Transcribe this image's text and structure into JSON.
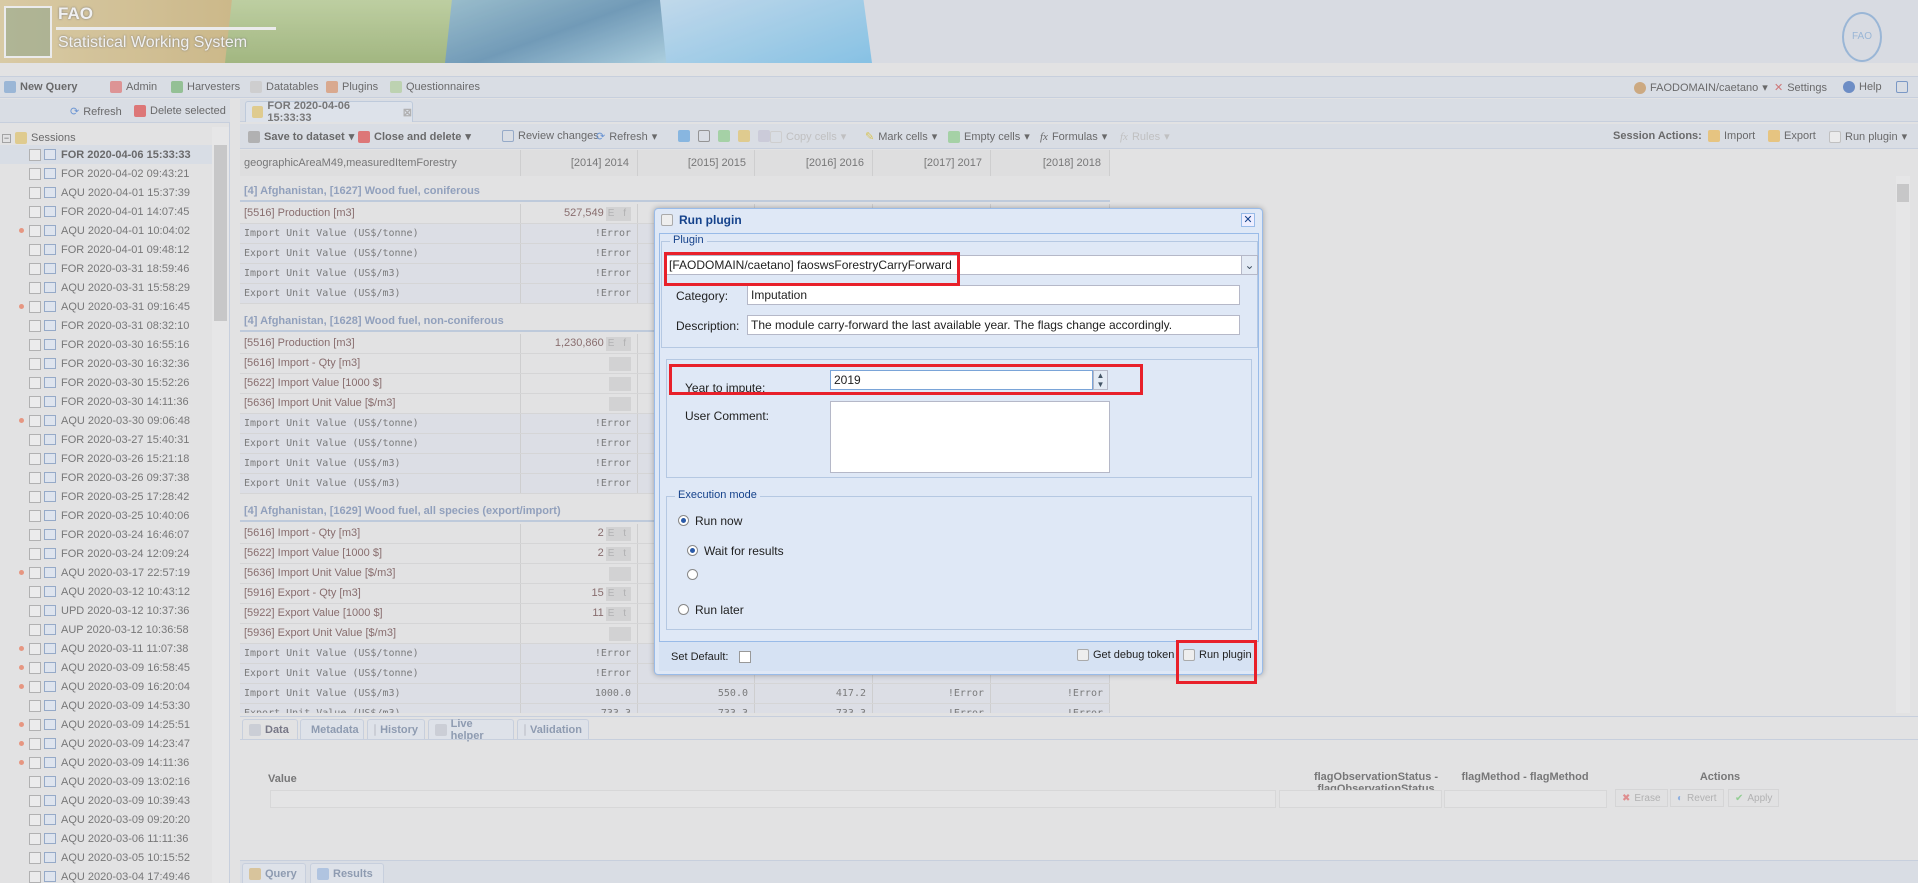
{
  "banner": {
    "app": "FAO",
    "subtitle": "Statistical Working System",
    "seal": "FAO"
  },
  "mainbar": {
    "new_query": "New Query",
    "admin": "Admin",
    "harvesters": "Harvesters",
    "datatables": "Datatables",
    "plugins": "Plugins",
    "questionnaires": "Questionnaires",
    "user": "FAODOMAIN/caetano",
    "settings": "Settings",
    "help": "Help"
  },
  "left": {
    "refresh": "Refresh",
    "delete_selected": "Delete selected",
    "sessions_label": "Sessions",
    "sessions": [
      {
        "name": "FOR 2020-04-06 15:33:33",
        "selected": true,
        "marked": false
      },
      {
        "name": "FOR 2020-04-02 09:43:21",
        "marked": false
      },
      {
        "name": "AQU 2020-04-01 15:37:39",
        "marked": false
      },
      {
        "name": "FOR 2020-04-01 14:07:45",
        "marked": false
      },
      {
        "name": "AQU 2020-04-01 10:04:02",
        "marked": true
      },
      {
        "name": "FOR 2020-04-01 09:48:12",
        "marked": false
      },
      {
        "name": "FOR 2020-03-31 18:59:46",
        "marked": false
      },
      {
        "name": "AQU 2020-03-31 15:58:29",
        "marked": false
      },
      {
        "name": "AQU 2020-03-31 09:16:45",
        "marked": true
      },
      {
        "name": "FOR 2020-03-31 08:32:10",
        "marked": false
      },
      {
        "name": "FOR 2020-03-30 16:55:16",
        "marked": false
      },
      {
        "name": "FOR 2020-03-30 16:32:36",
        "marked": false
      },
      {
        "name": "FOR 2020-03-30 15:52:26",
        "marked": false
      },
      {
        "name": "FOR 2020-03-30 14:11:36",
        "marked": false
      },
      {
        "name": "AQU 2020-03-30 09:06:48",
        "marked": true
      },
      {
        "name": "FOR 2020-03-27 15:40:31",
        "marked": false
      },
      {
        "name": "FOR 2020-03-26 15:21:18",
        "marked": false
      },
      {
        "name": "FOR 2020-03-26 09:37:38",
        "marked": false
      },
      {
        "name": "FOR 2020-03-25 17:28:42",
        "marked": false
      },
      {
        "name": "FOR 2020-03-25 10:40:06",
        "marked": false
      },
      {
        "name": "FOR 2020-03-24 16:46:07",
        "marked": false
      },
      {
        "name": "FOR 2020-03-24 12:09:24",
        "marked": false
      },
      {
        "name": "AQU 2020-03-17 22:57:19",
        "marked": true
      },
      {
        "name": "AQU 2020-03-12 10:43:12",
        "marked": false
      },
      {
        "name": "UPD 2020-03-12 10:37:36",
        "marked": false
      },
      {
        "name": "AUP 2020-03-12 10:36:58",
        "marked": false
      },
      {
        "name": "AQU 2020-03-11 11:07:38",
        "marked": true
      },
      {
        "name": "AQU 2020-03-09 16:58:45",
        "marked": true
      },
      {
        "name": "AQU 2020-03-09 16:20:04",
        "marked": true
      },
      {
        "name": "AQU 2020-03-09 14:53:30",
        "marked": false
      },
      {
        "name": "AQU 2020-03-09 14:25:51",
        "marked": true
      },
      {
        "name": "AQU 2020-03-09 14:23:47",
        "marked": true
      },
      {
        "name": "AQU 2020-03-09 14:11:36",
        "marked": true
      },
      {
        "name": "AQU 2020-03-09 13:02:16",
        "marked": false
      },
      {
        "name": "AQU 2020-03-09 10:39:43",
        "marked": false
      },
      {
        "name": "AQU 2020-03-09 09:20:20",
        "marked": false
      },
      {
        "name": "AQU 2020-03-06 11:11:36",
        "marked": false
      },
      {
        "name": "AQU 2020-03-05 10:15:52",
        "marked": false
      },
      {
        "name": "AQU 2020-03-04 17:49:46",
        "marked": false
      }
    ]
  },
  "session_tab": "FOR 2020-04-06 15:33:33",
  "toolbar": {
    "save": "Save to dataset",
    "close_delete": "Close and delete",
    "review": "Review changes",
    "refresh": "Refresh",
    "copy_cells": "Copy cells",
    "mark_cells": "Mark cells",
    "empty_cells": "Empty cells",
    "formulas": "Formulas",
    "rules": "Rules",
    "session_actions": "Session Actions:",
    "import": "Import",
    "export": "Export",
    "run_plugin": "Run plugin"
  },
  "grid": {
    "columns": [
      "geographicAreaM49,measuredItemForestry",
      "[2014] 2014",
      "[2015] 2015",
      "[2016] 2016",
      "[2017] 2017",
      "[2018] 2018"
    ],
    "groups": [
      {
        "title": "[4] Afghanistan, [1627] Wood fuel, coniferous",
        "rows": [
          {
            "label": "[5516] Production [m3]",
            "type": "meas",
            "values": [
              {
                "v": "527,549",
                "f": "E f"
              },
              "",
              "",
              "",
              ""
            ]
          },
          {
            "label": "Import Unit Value (US$/tonne)",
            "type": "calc",
            "values": [
              "!Error",
              "",
              "",
              "",
              ""
            ]
          },
          {
            "label": "Export Unit Value (US$/tonne)",
            "type": "calc",
            "values": [
              "!Error",
              "",
              "",
              "",
              ""
            ]
          },
          {
            "label": "Import Unit Value (US$/m3)",
            "type": "calc",
            "values": [
              "!Error",
              "",
              "",
              "",
              ""
            ]
          },
          {
            "label": "Export Unit Value (US$/m3)",
            "type": "calc",
            "values": [
              "!Error",
              "",
              "",
              "",
              ""
            ]
          }
        ]
      },
      {
        "title": "[4] Afghanistan, [1628] Wood fuel, non-coniferous",
        "rows": [
          {
            "label": "[5516] Production [m3]",
            "type": "meas",
            "values": [
              {
                "v": "1,230,860",
                "f": "E f"
              },
              "",
              "",
              "",
              ""
            ]
          },
          {
            "label": "[5616] Import - Qty [m3]",
            "type": "meas",
            "values": [
              {
                "v": "",
                "f": ""
              },
              "",
              "",
              "",
              ""
            ]
          },
          {
            "label": "[5622] Import Value [1000 $]",
            "type": "meas",
            "values": [
              {
                "v": "",
                "f": ""
              },
              "",
              "",
              "",
              ""
            ]
          },
          {
            "label": "[5636] Import Unit Value [$/m3]",
            "type": "meas",
            "values": [
              {
                "v": "",
                "f": ""
              },
              "",
              "",
              "",
              ""
            ]
          },
          {
            "label": "Import Unit Value (US$/tonne)",
            "type": "calc",
            "values": [
              "!Error",
              "",
              "",
              "",
              ""
            ]
          },
          {
            "label": "Export Unit Value (US$/tonne)",
            "type": "calc",
            "values": [
              "!Error",
              "",
              "",
              "",
              ""
            ]
          },
          {
            "label": "Import Unit Value (US$/m3)",
            "type": "calc",
            "values": [
              "!Error",
              "",
              "",
              "",
              ""
            ]
          },
          {
            "label": "Export Unit Value (US$/m3)",
            "type": "calc",
            "values": [
              "!Error",
              "",
              "",
              "",
              ""
            ]
          }
        ]
      },
      {
        "title": "[4] Afghanistan, [1629] Wood fuel, all species (export/import)",
        "rows": [
          {
            "label": "[5616] Import - Qty [m3]",
            "type": "meas",
            "values": [
              {
                "v": "2",
                "f": "E t"
              },
              "",
              "",
              "",
              ""
            ]
          },
          {
            "label": "[5622] Import Value [1000 $]",
            "type": "meas",
            "values": [
              {
                "v": "2",
                "f": "E t"
              },
              "",
              "",
              "",
              ""
            ]
          },
          {
            "label": "[5636] Import Unit Value [$/m3]",
            "type": "meas",
            "values": [
              {
                "v": "",
                "f": ""
              },
              "",
              "",
              "",
              ""
            ]
          },
          {
            "label": "[5916] Export - Qty [m3]",
            "type": "meas",
            "values": [
              {
                "v": "15",
                "f": "E t"
              },
              "",
              "",
              "",
              ""
            ]
          },
          {
            "label": "[5922] Export Value [1000 $]",
            "type": "meas",
            "values": [
              {
                "v": "11",
                "f": "E t"
              },
              "",
              "",
              "",
              ""
            ]
          },
          {
            "label": "[5936] Export Unit Value [$/m3]",
            "type": "meas",
            "values": [
              {
                "v": "",
                "f": ""
              },
              "",
              "",
              "",
              ""
            ]
          },
          {
            "label": "Import Unit Value (US$/tonne)",
            "type": "calc",
            "values": [
              "!Error",
              "",
              "",
              "",
              ""
            ]
          },
          {
            "label": "Export Unit Value (US$/tonne)",
            "type": "calc",
            "values": [
              "!Error",
              "",
              "",
              "",
              ""
            ]
          },
          {
            "label": "Import Unit Value (US$/m3)",
            "type": "calc",
            "values": [
              "1000.0",
              "550.0",
              "417.2",
              "!Error",
              "!Error"
            ]
          },
          {
            "label": "Export Unit Value (US$/m3)",
            "type": "calc",
            "values": [
              "733.3",
              "733.3",
              "733.3",
              "!Error",
              "!Error"
            ]
          }
        ]
      }
    ]
  },
  "bottom": {
    "tabs": [
      "Data",
      "Metadata",
      "History",
      "Live helper",
      "Validation"
    ],
    "value_label": "Value",
    "flag_obs_label": "flagObservationStatus - flagObservationStatus",
    "flag_method_label": "flagMethod - flagMethod",
    "actions_label": "Actions",
    "erase": "Erase",
    "revert": "Revert",
    "apply": "Apply",
    "query_tabs": [
      "Query",
      "Results"
    ]
  },
  "dialog": {
    "title": "Run plugin",
    "plugin_legend": "Plugin",
    "plugin_value": "[FAODOMAIN/caetano] faoswsForestryCarryForward",
    "category_label": "Category:",
    "category_value": "Imputation",
    "description_label": "Description:",
    "description_value": "The module carry-forward the last available year. The flags change accordingly.",
    "year_label": "Year to impute:",
    "year_value": "2019",
    "comment_label": "User Comment:",
    "comment_value": "",
    "exec_legend": "Execution mode",
    "run_now": "Run now",
    "wait_results": "Wait for results",
    "run_later": "Run later",
    "set_default": "Set Default:",
    "debug_token": "Get debug token",
    "run_plugin": "Run plugin",
    "highlight_color": "#e8202a"
  }
}
